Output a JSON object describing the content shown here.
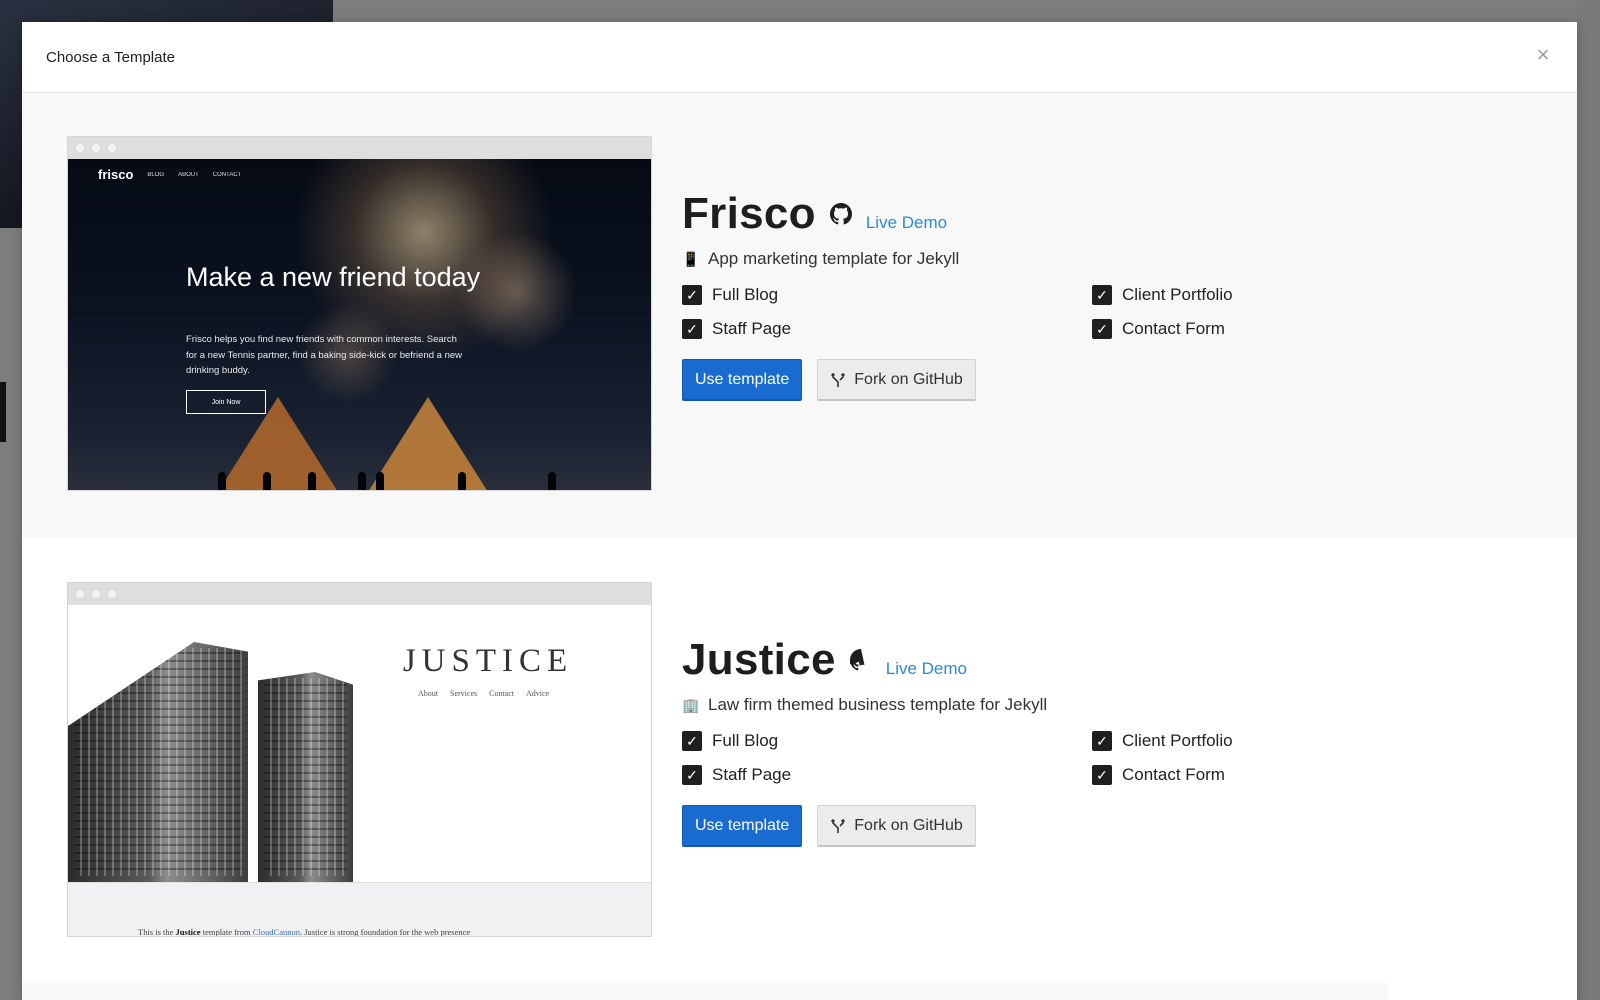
{
  "modal": {
    "title": "Choose a Template",
    "close_symbol": "×"
  },
  "templates": [
    {
      "name": "Frisco",
      "github_icon": "github-icon",
      "live_demo": "Live Demo",
      "emoji_icon": "mobile-phone-icon",
      "emoji": "📱",
      "description": "App marketing template for Jekyll",
      "features": [
        "Full Blog",
        "Client Portfolio",
        "Staff Page",
        "Contact Form"
      ],
      "use_label": "Use template",
      "fork_label": "Fork on GitHub",
      "preview": {
        "logo": "frisco",
        "nav": [
          "BLOG",
          "ABOUT",
          "CONTACT"
        ],
        "headline": "Make a new friend today",
        "subtext": "Frisco helps you find new friends with common interests. Search for a new Tennis partner, find a baking side-kick or befriend a new drinking buddy.",
        "cta": "Join Now"
      }
    },
    {
      "name": "Justice",
      "github_icon": "github-icon",
      "live_demo": "Live Demo",
      "emoji_icon": "office-building-icon",
      "emoji": "🏢",
      "description": "Law firm themed business template for Jekyll",
      "features": [
        "Full Blog",
        "Client Portfolio",
        "Staff Page",
        "Contact Form"
      ],
      "use_label": "Use template",
      "fork_label": "Fork on GitHub",
      "preview": {
        "title": "JUSTICE",
        "nav": [
          "About",
          "Services",
          "Contact",
          "Advice"
        ],
        "caption_pre": "This is the",
        "caption_brand": "Justice",
        "caption_mid": "template from",
        "caption_link": "CloudCannon",
        "caption_post": ". Justice is strong foundation for the web presence"
      }
    }
  ],
  "colors": {
    "primary_button": "#1a6bd0",
    "link": "#2a8ccf",
    "row_alt_bg": "#f8f8f8"
  }
}
